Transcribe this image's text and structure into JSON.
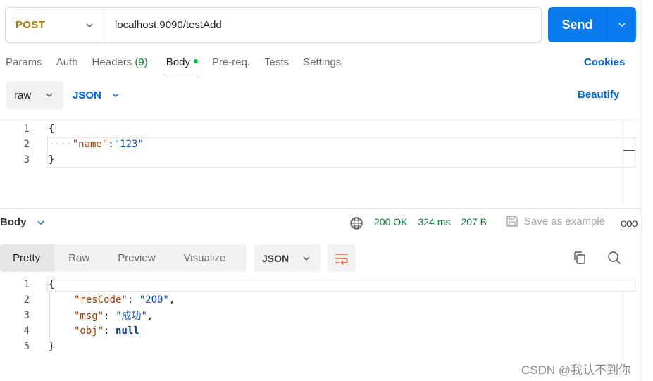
{
  "request": {
    "method": "POST",
    "url": "localhost:9090/testAdd",
    "send_label": "Send"
  },
  "tabs": {
    "params": "Params",
    "auth": "Auth",
    "headers": "Headers",
    "headers_count": "(9)",
    "body": "Body",
    "prereq": "Pre-req.",
    "tests": "Tests",
    "settings": "Settings",
    "cookies": "Cookies"
  },
  "body_toolbar": {
    "mode": "raw",
    "language": "JSON",
    "beautify": "Beautify"
  },
  "request_body": {
    "line_numbers": [
      "1",
      "2",
      "3"
    ],
    "open_brace": "{",
    "indent_dots": "····",
    "key": "\"name\"",
    "colon": ":",
    "value": "\"123\"",
    "close_brace": "}"
  },
  "response": {
    "section_label": "Body",
    "status": "200 OK",
    "time": "324 ms",
    "size": "207 B",
    "save_example": "Save as example",
    "more": "ooo",
    "view_tabs": [
      "Pretty",
      "Raw",
      "Preview",
      "Visualize"
    ],
    "language": "JSON",
    "line_numbers": [
      "1",
      "2",
      "3",
      "4",
      "5"
    ],
    "open_brace": "{",
    "close_brace": "}",
    "lines": [
      {
        "key": "\"resCode\"",
        "sep": ": ",
        "value": "\"200\"",
        "trail": ","
      },
      {
        "key": "\"msg\"",
        "sep": ": ",
        "value": "\"成功\"",
        "trail": ","
      },
      {
        "key": "\"obj\"",
        "sep": ": ",
        "value": "null",
        "trail": ""
      }
    ]
  },
  "watermark": "CSDN @我认不到你",
  "colors": {
    "method": "#ad7a03",
    "send": "#097bed",
    "link": "#0265d2",
    "status_ok": "#007f31",
    "tab_underline": "#ff6c37"
  }
}
